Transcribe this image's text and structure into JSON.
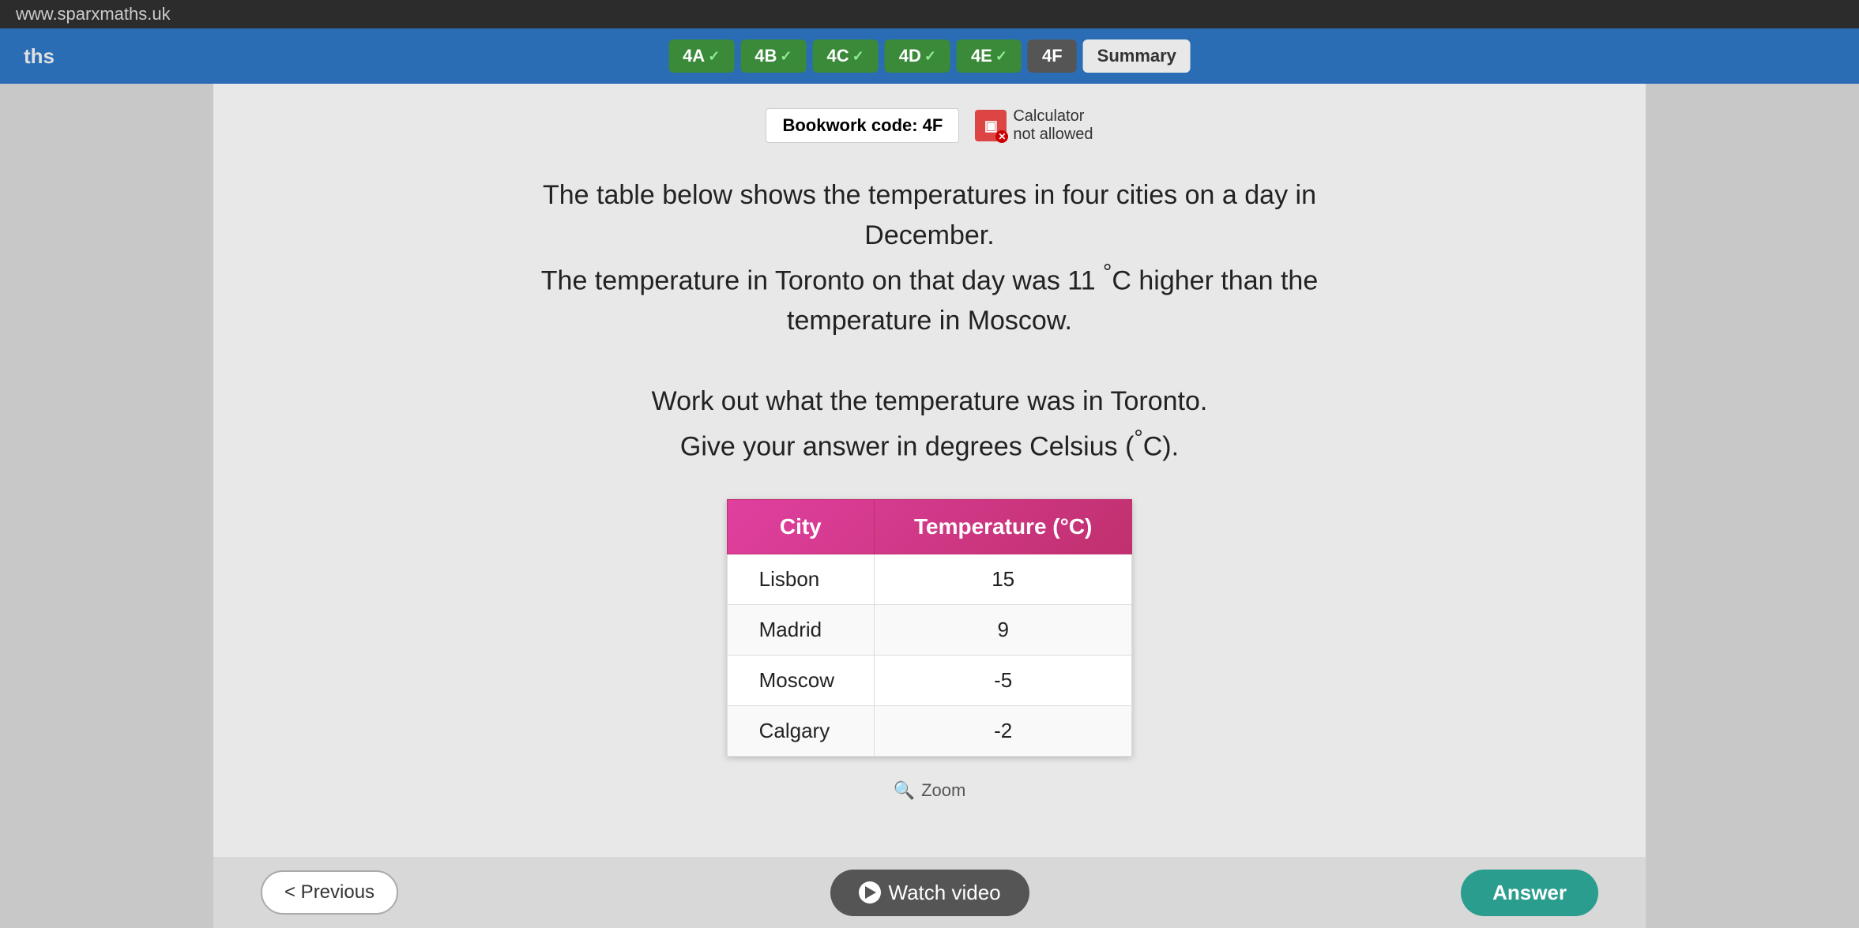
{
  "browser": {
    "url": "www.sparxmaths.uk"
  },
  "nav": {
    "site_label": "ths",
    "tabs": [
      {
        "id": "4A",
        "label": "4A",
        "completed": true
      },
      {
        "id": "4B",
        "label": "4B",
        "completed": true
      },
      {
        "id": "4C",
        "label": "4C",
        "completed": true
      },
      {
        "id": "4D",
        "label": "4D",
        "completed": true
      },
      {
        "id": "4E",
        "label": "4E",
        "completed": true
      },
      {
        "id": "4F",
        "label": "4F",
        "active": true
      },
      {
        "id": "Summary",
        "label": "Summary"
      }
    ]
  },
  "bookwork": {
    "label": "Bookwork code: 4F",
    "calculator_label": "Calculator",
    "calculator_status": "not allowed"
  },
  "question": {
    "line1": "The table below shows the temperatures in four cities on a day in",
    "line2": "December.",
    "line3": "The temperature in Toronto on that day was 11 °C higher than the",
    "line4": "temperature in Moscow.",
    "line5": "Work out what the temperature was in Toronto.",
    "line6": "Give your answer in degrees Celsius (°C)."
  },
  "table": {
    "col1_header": "City",
    "col2_header": "Temperature (°C)",
    "rows": [
      {
        "city": "Lisbon",
        "temp": "15"
      },
      {
        "city": "Madrid",
        "temp": "9"
      },
      {
        "city": "Moscow",
        "temp": "-5"
      },
      {
        "city": "Calgary",
        "temp": "-2"
      }
    ]
  },
  "zoom": {
    "label": "Zoom"
  },
  "buttons": {
    "previous": "< Previous",
    "watch_video": "Watch video",
    "answer": "Answer"
  }
}
